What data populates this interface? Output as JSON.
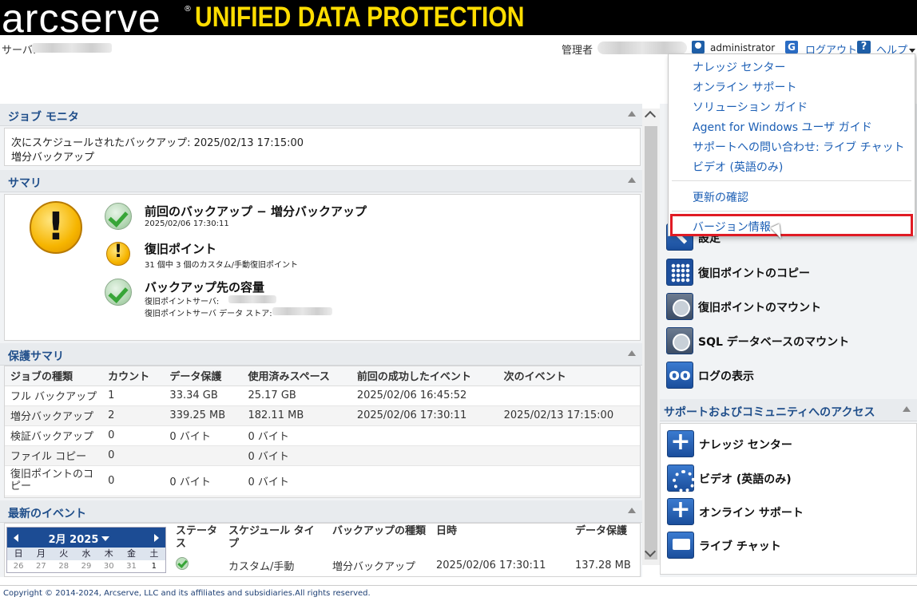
{
  "banner": {
    "logo": "arcserve",
    "registered": "®",
    "product": "UNIFIED DATA PROTECTION"
  },
  "topbar": {
    "server_label": "サーバ:",
    "admin_label": "管理者",
    "user_name": "administrator",
    "logout_icon": "G",
    "logout": "ログアウト",
    "help_icon": "?",
    "help": "ヘルプ"
  },
  "help_menu": {
    "items": [
      "ナレッジ センター",
      "オンライン サポート",
      "ソリューション ガイド",
      "Agent for Windows ユーザ ガイド",
      "サポートへの問い合わせ: ライブ チャット",
      "ビデオ (英語のみ)"
    ],
    "check_updates": "更新の確認",
    "version_info": "バージョン情報"
  },
  "job_monitor": {
    "title": "ジョブ モニタ",
    "text": "次にスケジュールされたバックアップ: 2025/02/13 17:15:00 増分バックアップ"
  },
  "summary": {
    "title": "サマリ",
    "rows": [
      {
        "status": "ok",
        "title": "前回のバックアップ − 増分バックアップ",
        "sub1": "2025/02/06 17:30:11",
        "sub2": ""
      },
      {
        "status": "warn",
        "title": "復旧ポイント",
        "sub1": "31 個中 3 個のカスタム/手動復旧ポイント",
        "sub2": ""
      },
      {
        "status": "ok",
        "title": "バックアップ先の容量",
        "sub1": "復旧ポイントサーバ:",
        "sub2": "復旧ポイントサーバ データ ストア:"
      }
    ]
  },
  "protection_summary": {
    "title": "保護サマリ",
    "headers": [
      "ジョブの種類",
      "カウント",
      "データ保護",
      "使用済みスペース",
      "前回の成功したイベント",
      "次のイベント"
    ],
    "rows": [
      [
        "フル バックアップ",
        "1",
        "33.34 GB",
        "25.17 GB",
        "2025/02/06 16:45:52",
        ""
      ],
      [
        "増分バックアップ",
        "2",
        "339.25 MB",
        "182.11 MB",
        "2025/02/06 17:30:11",
        "2025/02/13 17:15:00"
      ],
      [
        "検証バックアップ",
        "0",
        "0 バイト",
        "0 バイト",
        "",
        ""
      ],
      [
        "ファイル コピー",
        "0",
        "",
        "0 バイト",
        "",
        ""
      ],
      [
        "復旧ポイントのコピー",
        "0",
        "0 バイト",
        "0 バイト",
        "",
        ""
      ]
    ]
  },
  "recent_events": {
    "title": "最新のイベント",
    "calendar": {
      "month": "2月 2025",
      "days": [
        "日",
        "月",
        "火",
        "水",
        "木",
        "金",
        "土"
      ],
      "dates": [
        "26",
        "27",
        "28",
        "29",
        "30",
        "31",
        "1"
      ]
    },
    "headers": [
      "ステータス",
      "スケジュール タイプ",
      "バックアップの種類",
      "日時",
      "データ保護"
    ],
    "rows": [
      [
        "",
        "カスタム/手動",
        "増分バックアップ",
        "2025/02/06 17:30:11",
        "137.28 MB"
      ]
    ]
  },
  "tasks": {
    "settings": "設定",
    "items": [
      "復旧ポイントのコピー",
      "復旧ポイントのマウント",
      "SQL データベースのマウント",
      "ログの表示"
    ]
  },
  "support": {
    "title": "サポートおよびコミュニティへのアクセス",
    "items": [
      "ナレッジ センター",
      "ビデオ (英語のみ)",
      "オンライン サポート",
      "ライブ チャット"
    ]
  },
  "footer": {
    "text": "Copyright © 2014-2024, Arcserve, LLC and its affiliates and subsidiaries.All rights reserved."
  }
}
